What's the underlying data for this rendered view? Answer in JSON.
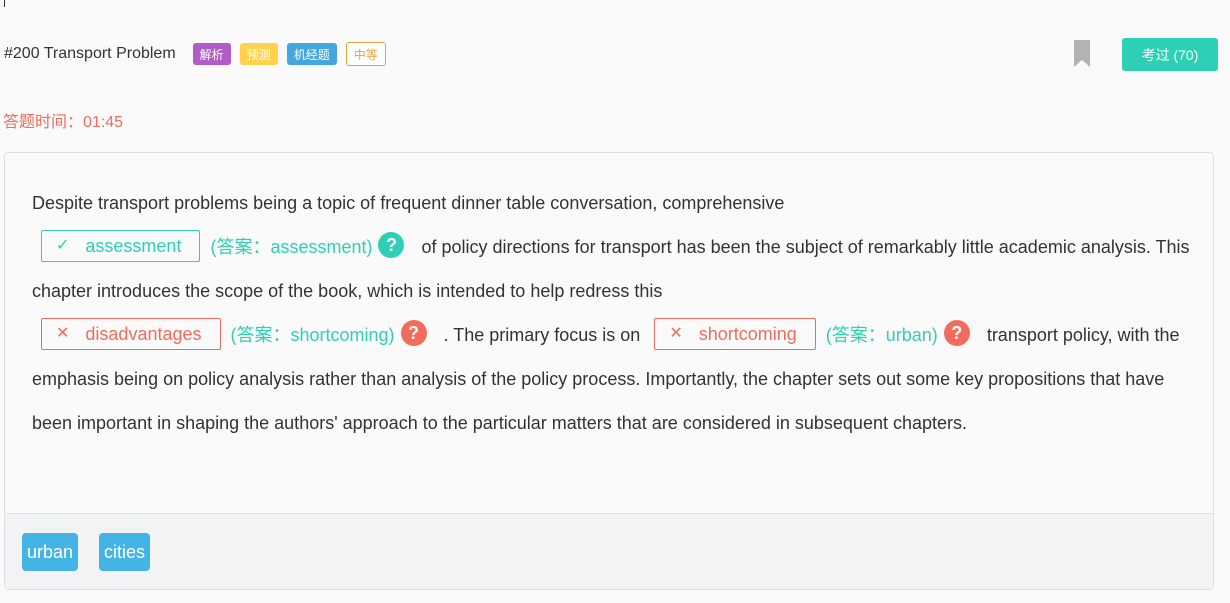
{
  "header": {
    "title": "#200 Transport Problem",
    "tags": [
      "解析",
      "预测",
      "机经题",
      "中等"
    ],
    "pass_label": "考过 (70)"
  },
  "timer": {
    "label": "答题时间：",
    "value": "01:45"
  },
  "passage": {
    "seg1": "Despite transport problems being a topic of frequent dinner table conversation, comprehensive",
    "blank1": {
      "mark": "✓",
      "text": "assessment",
      "answer": "(答案：assessment)"
    },
    "seg2": "of policy directions for transport has been the subject of remarkably little academic analysis. This chapter introduces the scope of the book, which is intended to help redress this",
    "blank2": {
      "mark": "✕",
      "text": "disadvantages",
      "answer": "(答案：shortcoming)"
    },
    "seg3": ". The primary focus is on",
    "blank3": {
      "mark": "✕",
      "text": "shortcoming",
      "answer": "(答案：urban)"
    },
    "seg4": "transport policy, with the emphasis being on policy analysis rather than analysis of the policy process. Importantly, the chapter sets out some key propositions that have been important in shaping the authors' approach to the particular matters that are considered in subsequent chapters.",
    "qmark": "?"
  },
  "keywords": [
    "urban",
    "cities"
  ],
  "colors": {
    "accent": "#2dd0b4",
    "error": "#f26b5b",
    "keyword": "#43b4e4"
  },
  "icons": {
    "bookmark": "bookmark-icon",
    "check": "check-icon",
    "cross": "cross-icon",
    "help": "question-icon"
  }
}
